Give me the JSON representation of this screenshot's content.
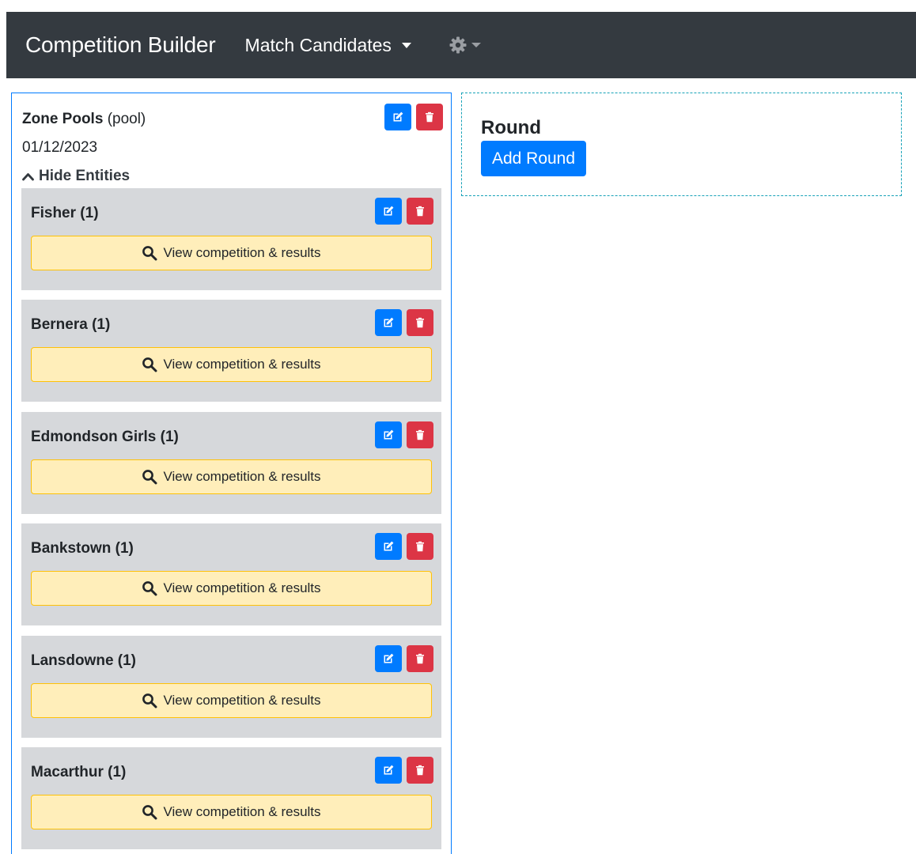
{
  "navbar": {
    "brand": "Competition Builder",
    "menu_label": "Match Candidates",
    "settings_icon": "gear-icon"
  },
  "pool": {
    "name": "Zone Pools",
    "type": "(pool)",
    "date": "01/12/2023",
    "toggle_label": "Hide Entities"
  },
  "entities": [
    {
      "name": "Fisher (1)",
      "view_label": "View competition & results"
    },
    {
      "name": "Bernera (1)",
      "view_label": "View competition & results"
    },
    {
      "name": "Edmondson Girls (1)",
      "view_label": "View competition & results"
    },
    {
      "name": "Bankstown (1)",
      "view_label": "View competition & results"
    },
    {
      "name": "Lansdowne (1)",
      "view_label": "View competition & results"
    },
    {
      "name": "Macarthur (1)",
      "view_label": "View competition & results"
    }
  ],
  "round": {
    "title": "Round",
    "add_label": "Add Round"
  },
  "colors": {
    "primary": "#007bff",
    "danger": "#dc3545",
    "warning_bg": "#ffeeba",
    "warning_border": "#ffc107",
    "navbar": "#343a40",
    "entity_bg": "#d6d8db"
  }
}
